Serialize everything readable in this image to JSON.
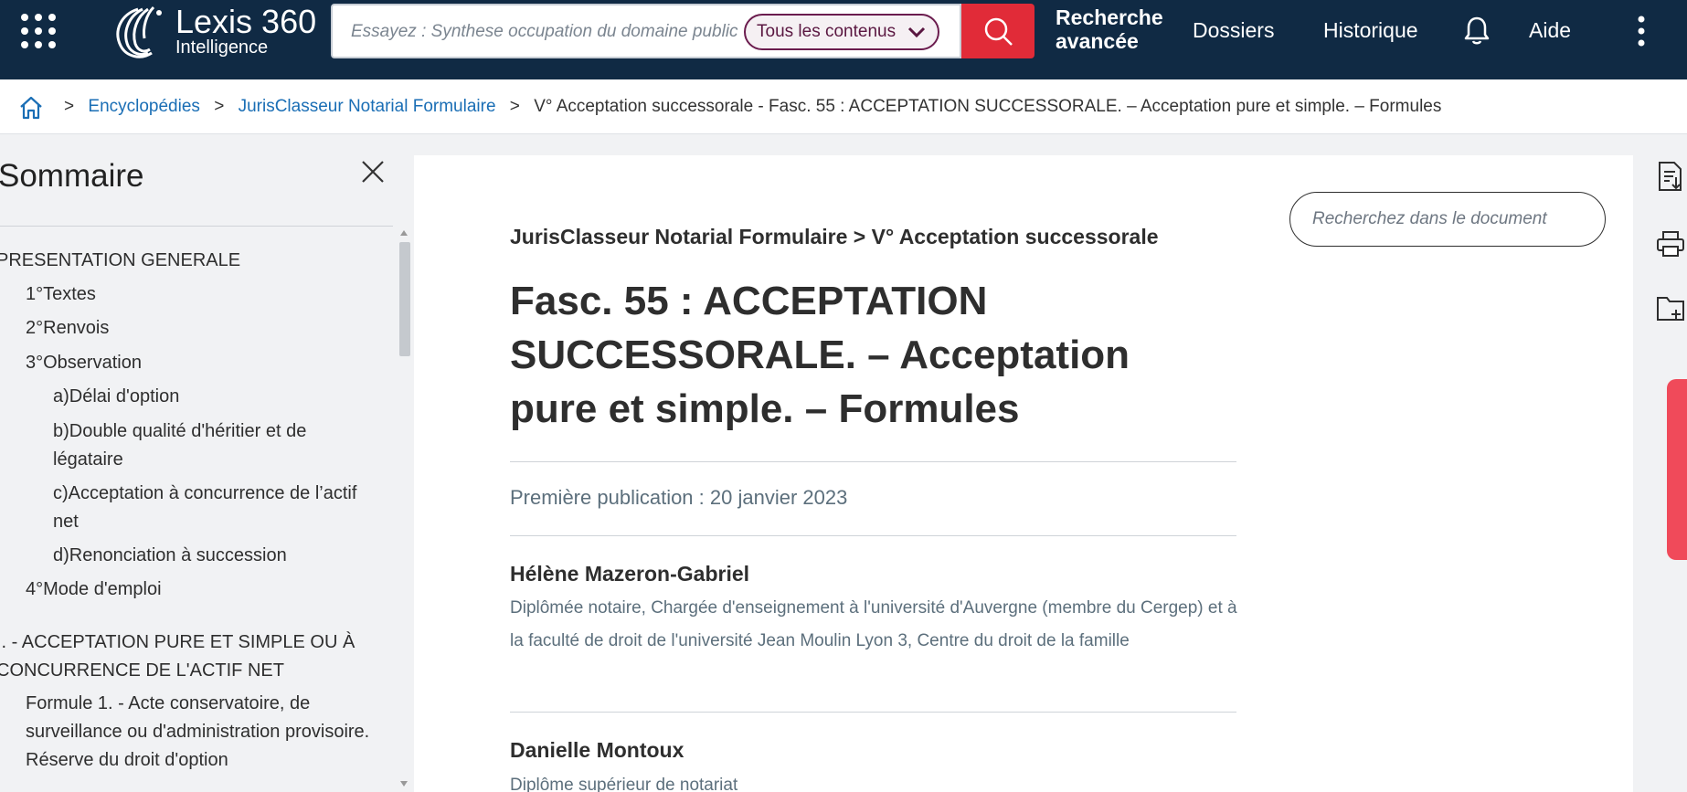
{
  "header": {
    "logo_brand": "Lexis 360",
    "logo_sub": "Intelligence",
    "search_placeholder": "Essayez : Synthese occupation du domaine public",
    "scope_selected": "Tous les contenus",
    "nav_advanced_line1": "Recherche",
    "nav_advanced_line2": "avancée",
    "nav_folders": "Dossiers",
    "nav_history": "Historique",
    "nav_help": "Aide"
  },
  "breadcrumb": {
    "items": [
      "Encyclopédies",
      "JurisClasseur Notarial Formulaire",
      "V° Acceptation successorale - Fasc. 55 : ACCEPTATION SUCCESSORALE. – Acceptation pure et simple. – Formules"
    ],
    "separator": ">"
  },
  "sidebar": {
    "title": "Sommaire",
    "toc": [
      "PRESENTATION GENERALE",
      "1°Textes",
      "2°Renvois",
      "3°Observation",
      "a)Délai d'option",
      "b)Double qualité d'héritier et de légataire",
      "c)Acceptation à concurrence de l’actif net",
      "d)Renonciation à succession",
      "4°Mode d'emploi",
      "I. - ACCEPTATION PURE ET SIMPLE OU À CONCURRENCE DE L'ACTIF NET",
      "Formule 1. - Acte conservatoire, de surveillance ou d'administration provisoire. Réserve du droit d'option"
    ]
  },
  "document": {
    "search_placeholder": "Recherchez dans le document",
    "path": "JurisClasseur Notarial Formulaire > V° Acceptation successorale",
    "title": "Fasc. 55 : ACCEPTATION SUCCESSORALE. – Acceptation pure et simple. – Formules",
    "publication": "Première publication : 20 janvier 2023",
    "authors": [
      {
        "name": "Hélène Mazeron-Gabriel",
        "role": "Diplômée notaire, Chargée d'enseignement à l'université d'Auvergne (membre du Cergep) et à la faculté de droit de l'université Jean Moulin Lyon 3, Centre du droit de la famille"
      },
      {
        "name": "Danielle Montoux",
        "role": "Diplôme supérieur de notariat"
      }
    ]
  },
  "colors": {
    "header_bg": "#102a44",
    "search_button": "#e12b38",
    "link": "#1a6eb5",
    "scope_border": "#6b1c4e",
    "feedback_tab": "#f04a5a",
    "meta_text": "#5c6f7c"
  },
  "icons": {
    "apps": "grid-icon",
    "search": "search-icon",
    "bell": "bell-icon",
    "kebab": "kebab-menu-icon",
    "home": "home-icon",
    "close": "close-icon",
    "rail": [
      "export-document-icon",
      "print-icon",
      "add-to-folder-icon"
    ]
  }
}
